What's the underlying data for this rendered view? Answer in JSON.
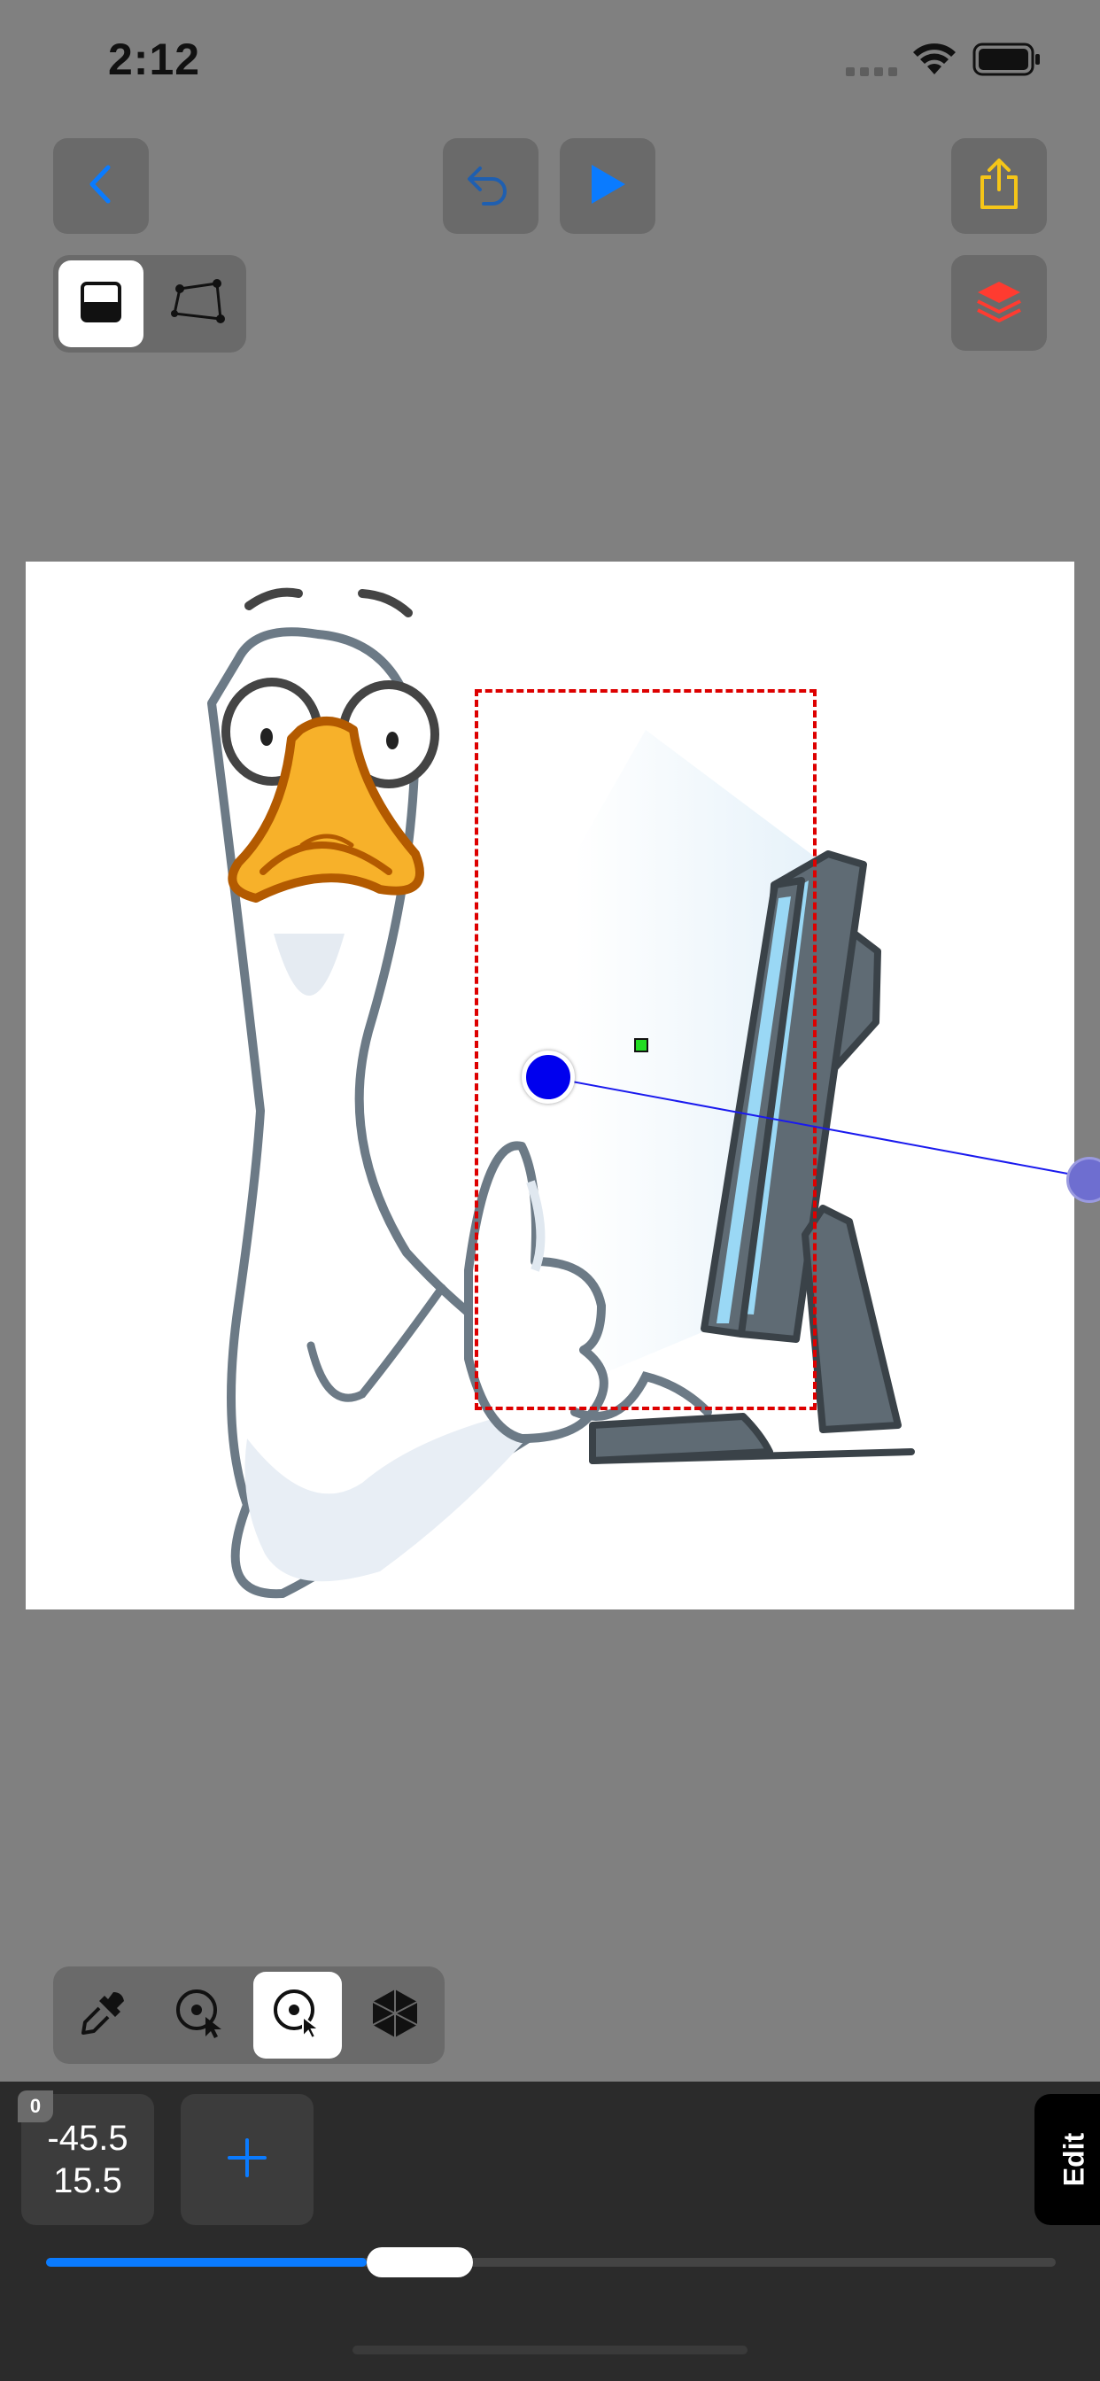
{
  "status_bar": {
    "time": "2:12",
    "icons": [
      "signal-dots-icon",
      "wifi-icon",
      "battery-icon"
    ]
  },
  "toolbar": {
    "back_icon": "chevron-left-icon",
    "undo_icon": "undo-icon",
    "play_icon": "play-icon",
    "share_icon": "share-icon",
    "layers_icon": "layers-icon",
    "mode_options": [
      "fill-mode-icon",
      "polygon-mode-icon"
    ],
    "selected_mode": 0
  },
  "tools": {
    "items": [
      "eyedropper-icon",
      "target-cursor-icon",
      "target-cursor-selected-icon",
      "cube-icon"
    ],
    "selected_index": 2
  },
  "bottom": {
    "badge": "0",
    "coord_x": "-45.5",
    "coord_y": "15.5",
    "add_icon": "plus-icon",
    "edit_label": "Edit",
    "slider_value": 0.37
  },
  "colors": {
    "background": "#808080",
    "accent_blue": "#0a7bff",
    "yellow": "#f5c518",
    "red": "#ff3b30",
    "selection_red": "#dd0000",
    "handle_blue": "#0000ee"
  }
}
